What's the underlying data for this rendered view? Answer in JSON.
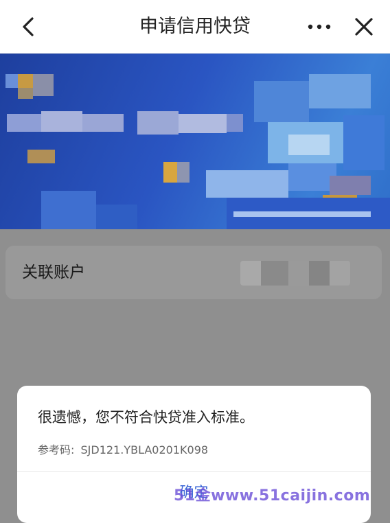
{
  "navbar": {
    "title": "申请信用快贷",
    "back_icon": "chevron-left-icon",
    "more_icon": "more-horizontal-icon",
    "close_icon": "close-icon"
  },
  "banner": {
    "primary_color": "#2a55c2"
  },
  "account": {
    "label": "关联账户"
  },
  "dialog": {
    "message": "很遗憾，您不符合快贷准入标准。",
    "ref_label": "参考码:",
    "ref_code": "SJD121.YBLA0201K098",
    "confirm_label": "确定"
  },
  "watermark": {
    "text": "51金www.51caijin.com"
  }
}
